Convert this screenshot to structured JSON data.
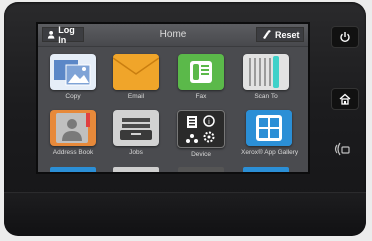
{
  "header": {
    "login_label": "Log In",
    "title": "Home",
    "reset_label": "Reset"
  },
  "apps": [
    {
      "label": "Copy"
    },
    {
      "label": "Email"
    },
    {
      "label": "Fax"
    },
    {
      "label": "Scan To"
    },
    {
      "label": "Address Book"
    },
    {
      "label": "Jobs"
    },
    {
      "label": "Device"
    },
    {
      "label": "Xerox® App Gallery"
    }
  ],
  "hard_buttons": {
    "power_icon": "power-icon",
    "home_icon": "home-icon",
    "nfc_icon": "nfc-icon"
  },
  "colors": {
    "copy": "#7fa3d6",
    "email": "#f0a52a",
    "fax": "#5bb94a",
    "scan": "#dcdcdc",
    "address_book": "#e7893a",
    "jobs": "#cfcfcf",
    "device": "#2a2a2a",
    "gallery": "#2b8fd6"
  }
}
